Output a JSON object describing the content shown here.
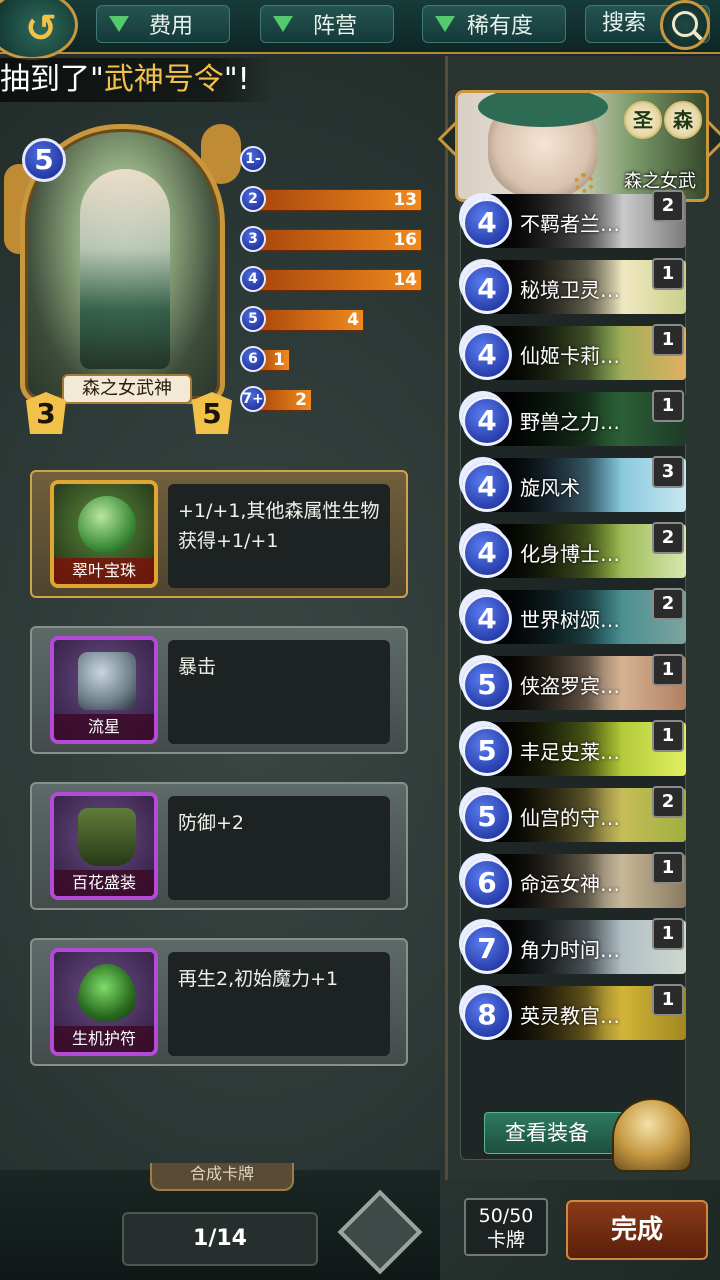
{
  "topbar": {
    "filters": [
      "费用",
      "阵营",
      "稀有度"
    ],
    "search_label": "搜索"
  },
  "banner": {
    "prefix": "抽到了\"",
    "highlight": "武神号令",
    "suffix": "\"!"
  },
  "hero_card": {
    "name": "森之女武神",
    "cost": "5",
    "attack": "3",
    "health": "5"
  },
  "mana_curve": [
    {
      "label": "1-",
      "count": null
    },
    {
      "label": "2",
      "count": 13
    },
    {
      "label": "3",
      "count": 16
    },
    {
      "label": "4",
      "count": 14
    },
    {
      "label": "5",
      "count": 4
    },
    {
      "label": "6",
      "count": 1
    },
    {
      "label": "7+",
      "count": 2
    }
  ],
  "equipment": [
    {
      "name": "翠叶宝珠",
      "desc": "+1/+1,其他森属性生物获得+1/+1"
    },
    {
      "name": "流星",
      "desc": "暴击"
    },
    {
      "name": "百花盛装",
      "desc": "防御+2"
    },
    {
      "name": "生机护符",
      "desc": "再生2,初始魔力+1"
    }
  ],
  "compose_tab": "合成卡牌",
  "page_indicator": "1/14",
  "deck_hero": {
    "name": "森之女武",
    "badges": [
      "圣",
      "森"
    ]
  },
  "deck": [
    {
      "cost": "4",
      "name": "不羁者兰…",
      "count": "2"
    },
    {
      "cost": "4",
      "name": "秘境卫灵…",
      "count": "1"
    },
    {
      "cost": "4",
      "name": "仙姬卡莉…",
      "count": "1"
    },
    {
      "cost": "4",
      "name": "野兽之力…",
      "count": "1"
    },
    {
      "cost": "4",
      "name": "旋风术",
      "count": "3"
    },
    {
      "cost": "4",
      "name": "化身博士…",
      "count": "2"
    },
    {
      "cost": "4",
      "name": "世界树颂…",
      "count": "2"
    },
    {
      "cost": "5",
      "name": "侠盗罗宾…",
      "count": "1"
    },
    {
      "cost": "5",
      "name": "丰足史莱…",
      "count": "1"
    },
    {
      "cost": "5",
      "name": "仙宫的守…",
      "count": "2"
    },
    {
      "cost": "6",
      "name": "命运女神…",
      "count": "1"
    },
    {
      "cost": "7",
      "name": "角力时间…",
      "count": "1"
    },
    {
      "cost": "8",
      "name": "英灵教官…",
      "count": "1"
    }
  ],
  "view_equipment": "查看装备",
  "deck_count": {
    "value": "50/50",
    "label": "卡牌"
  },
  "done": "完成"
}
